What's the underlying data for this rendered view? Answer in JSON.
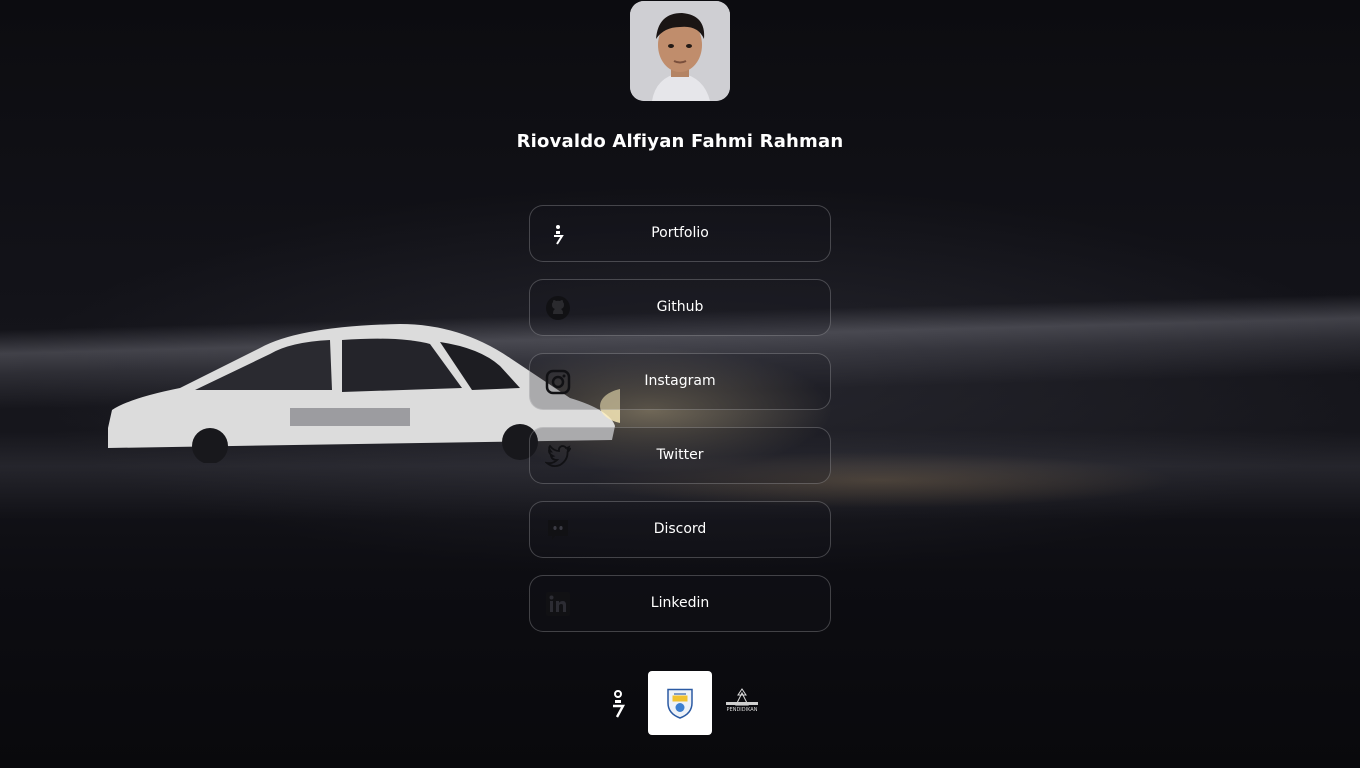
{
  "profile": {
    "name": "Riovaldo Alfiyan Fahmi Rahman"
  },
  "links": [
    {
      "label": "Portfolio",
      "icon": "portfolio-logo-icon"
    },
    {
      "label": "Github",
      "icon": "github-icon"
    },
    {
      "label": "Instagram",
      "icon": "instagram-icon"
    },
    {
      "label": "Twitter",
      "icon": "twitter-icon"
    },
    {
      "label": "Discord",
      "icon": "discord-icon"
    },
    {
      "label": "Linkedin",
      "icon": "linkedin-icon"
    }
  ],
  "footer": {
    "logos": [
      "portfolio-logo-icon",
      "school-crest-logo",
      "pendidikan-logo"
    ],
    "pendidikan_text": "PENDIDIKAN"
  },
  "colors": {
    "text": "#ffffff",
    "card_border": "rgba(255,255,255,0.22)",
    "background": "#0b0b0e"
  }
}
